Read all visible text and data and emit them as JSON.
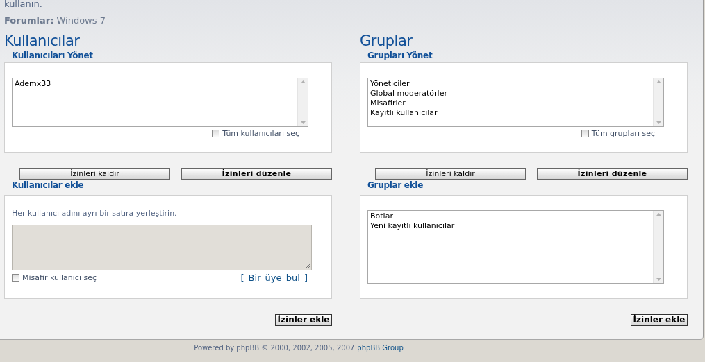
{
  "intro_text": "kullanın.",
  "forum": {
    "label": "Forumlar:",
    "value": "Windows 7"
  },
  "columns": [
    {
      "title": "Kullanıcılar",
      "manage": {
        "legend": "Kullanıcıları Yönet",
        "items": [
          {
            "label": "Ademx33",
            "selected": false
          }
        ],
        "select_all": {
          "label": "Tüm kullanıcıları seç",
          "checked": false
        }
      },
      "buttons": [
        {
          "label": "İzinleri kaldır",
          "primary": false
        },
        {
          "label": "İzinleri düzenle",
          "primary": true
        }
      ],
      "add": {
        "legend": "Kullanıcılar ekle",
        "kind": "textarea",
        "hint": "Her kullanıcı adını ayrı bir satıra yerleştirin.",
        "guest": {
          "label": "Misafir kullanıcı seç",
          "checked": false
        },
        "find_link": "[ Bir üye bul ]"
      },
      "submit": "İzinler ekle"
    },
    {
      "title": "Gruplar",
      "manage": {
        "legend": "Grupları Yönet",
        "items": [
          {
            "label": "Yöneticiler",
            "selected": false
          },
          {
            "label": "Global moderatörler",
            "selected": false
          },
          {
            "label": "Misafirler",
            "selected": false
          },
          {
            "label": "Kayıtlı kullanıcılar",
            "selected": false
          }
        ],
        "select_all": {
          "label": "Tüm grupları seç",
          "checked": false
        }
      },
      "buttons": [
        {
          "label": "İzinleri kaldır",
          "primary": false
        },
        {
          "label": "İzinleri düzenle",
          "primary": true
        }
      ],
      "add": {
        "legend": "Gruplar ekle",
        "kind": "listbox",
        "items": [
          {
            "label": "Botlar",
            "selected": false
          },
          {
            "label": "Yeni kayıtlı kullanıcılar",
            "selected": false
          }
        ]
      },
      "submit": "İzinler ekle"
    }
  ],
  "footer": {
    "text": "Powered by phpBB © 2000, 2002, 2005, 2007",
    "link": "phpBB Group"
  }
}
